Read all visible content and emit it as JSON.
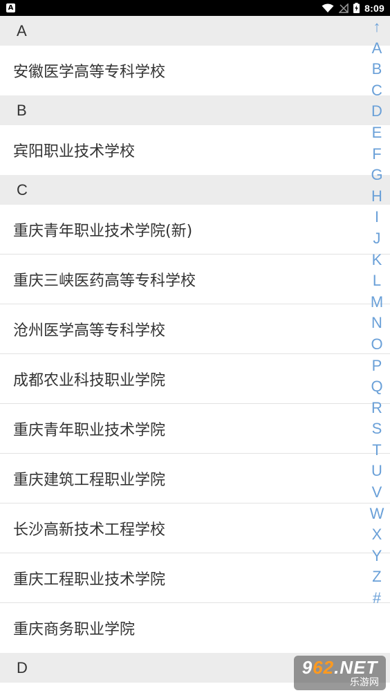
{
  "status_bar": {
    "notification_icon_letter": "A",
    "time": "8:09"
  },
  "sections": [
    {
      "letter": "A",
      "items": [
        "安徽医学高等专科学校"
      ]
    },
    {
      "letter": "B",
      "items": [
        "宾阳职业技术学校"
      ]
    },
    {
      "letter": "C",
      "items": [
        "重庆青年职业技术学院(新)",
        "重庆三峡医药高等专科学校",
        "沧州医学高等专科学校",
        "成都农业科技职业学院",
        "重庆青年职业技术学院",
        "重庆建筑工程职业学院",
        "长沙高新技术工程学校",
        "重庆工程职业技术学院",
        "重庆商务职业学院"
      ]
    },
    {
      "letter": "D",
      "items": []
    }
  ],
  "index_bar": [
    "↑",
    "A",
    "B",
    "C",
    "D",
    "E",
    "F",
    "G",
    "H",
    "I",
    "J",
    "K",
    "L",
    "M",
    "N",
    "O",
    "P",
    "Q",
    "R",
    "S",
    "T",
    "U",
    "V",
    "W",
    "X",
    "Y",
    "Z",
    "#"
  ],
  "watermark": {
    "logo_prefix": "9",
    "logo_accent": "62",
    "logo_suffix": ".NET",
    "sub": "乐游网"
  },
  "colors": {
    "index_letter": "#6aa0d8",
    "section_header_bg": "#ececec",
    "text": "#333333"
  }
}
